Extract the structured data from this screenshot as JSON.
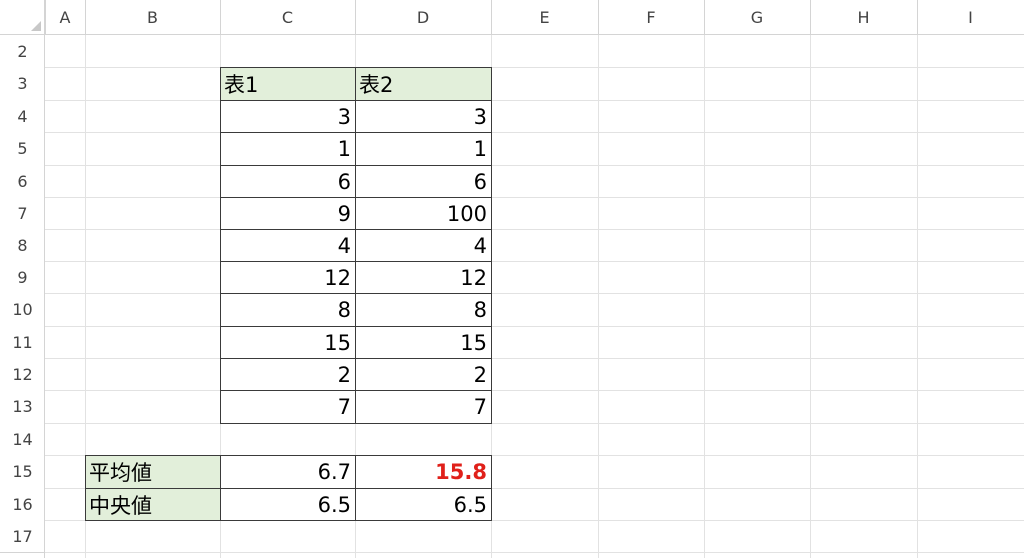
{
  "columns": [
    "A",
    "B",
    "C",
    "D",
    "E",
    "F",
    "G",
    "H",
    "I"
  ],
  "rows": [
    "2",
    "3",
    "4",
    "5",
    "6",
    "7",
    "8",
    "9",
    "10",
    "11",
    "12",
    "13",
    "14",
    "15",
    "16",
    "17"
  ],
  "table": {
    "header1": "表1",
    "header2": "表2",
    "col1": [
      "3",
      "1",
      "6",
      "9",
      "4",
      "12",
      "8",
      "15",
      "2",
      "7"
    ],
    "col2": [
      "3",
      "1",
      "6",
      "100",
      "4",
      "12",
      "8",
      "15",
      "2",
      "7"
    ]
  },
  "summary": {
    "mean_label": "平均値",
    "mean_c": "6.7",
    "mean_d": "15.8",
    "median_label": "中央値",
    "median_c": "6.5",
    "median_d": "6.5"
  },
  "colors": {
    "header_fill": "#e2efda",
    "highlight": "#e0201a"
  }
}
